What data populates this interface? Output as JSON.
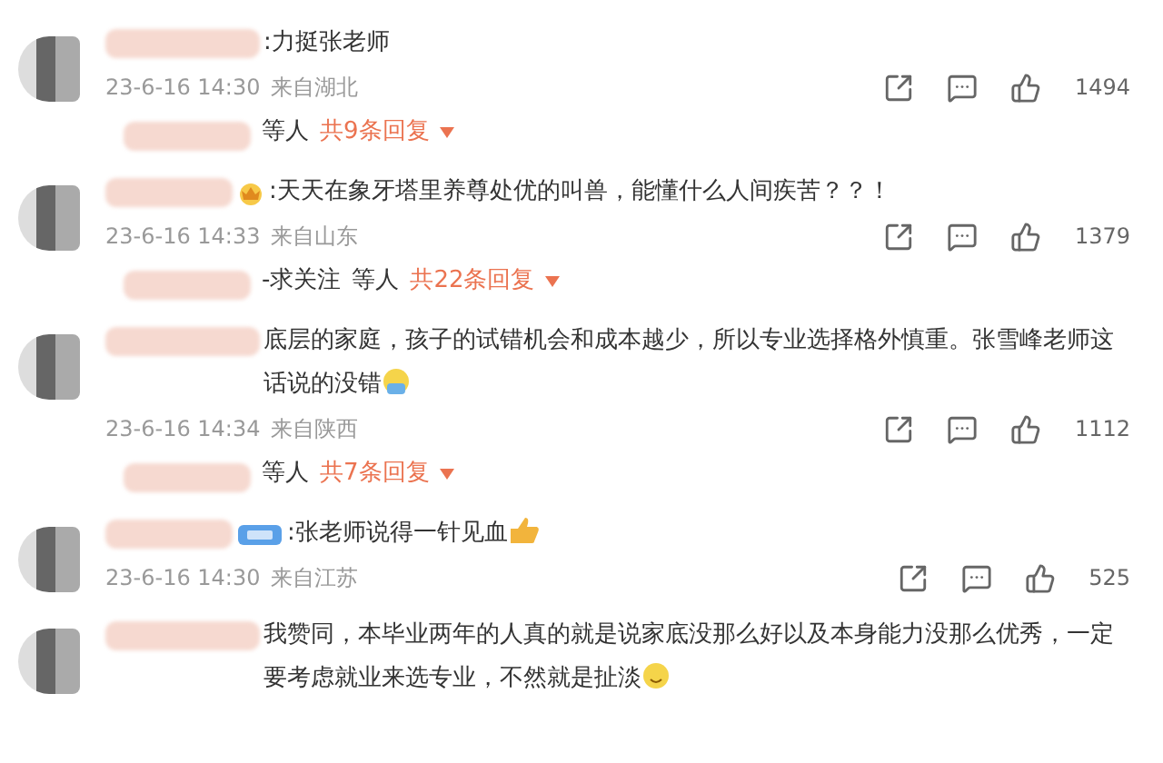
{
  "comments": [
    {
      "text": ":力挺张老师",
      "time": "23-6-16 14:30",
      "location": "来自湖北",
      "likes": "1494",
      "replies": {
        "suffix": "等人",
        "count": "共9条回复"
      }
    },
    {
      "badge": {
        "kind": "crown"
      },
      "text": ":天天在象牙塔里养尊处优的叫兽，能懂什么人间疾苦？？！",
      "time": "23-6-16 14:33",
      "location": "来自山东",
      "likes": "1379",
      "replies": {
        "names": "-求关注",
        "suffix": "等人",
        "count": "共22条回复"
      }
    },
    {
      "text": "底层的家庭，孩子的试错机会和成本越少，所以专业选择格外慎重。张雪峰老师这话说的没错",
      "emoji": {
        "kind": "sweat"
      },
      "time": "23-6-16 14:34",
      "location": "来自陕西",
      "likes": "1112",
      "replies": {
        "suffix": "等人",
        "count": "共7条回复"
      }
    },
    {
      "badge": {
        "kind": "tag"
      },
      "text": ":张老师说得一针见血",
      "emoji": {
        "kind": "thumbs"
      },
      "time": "23-6-16 14:30",
      "location": "来自江苏",
      "likes": "525"
    },
    {
      "text": "我赞同，本毕业两年的人真的就是说家底没那么好以及本身能力没那么优秀，一定要考虑就业来选专业，不然就是扯淡",
      "emoji": {
        "kind": "smile"
      }
    }
  ]
}
